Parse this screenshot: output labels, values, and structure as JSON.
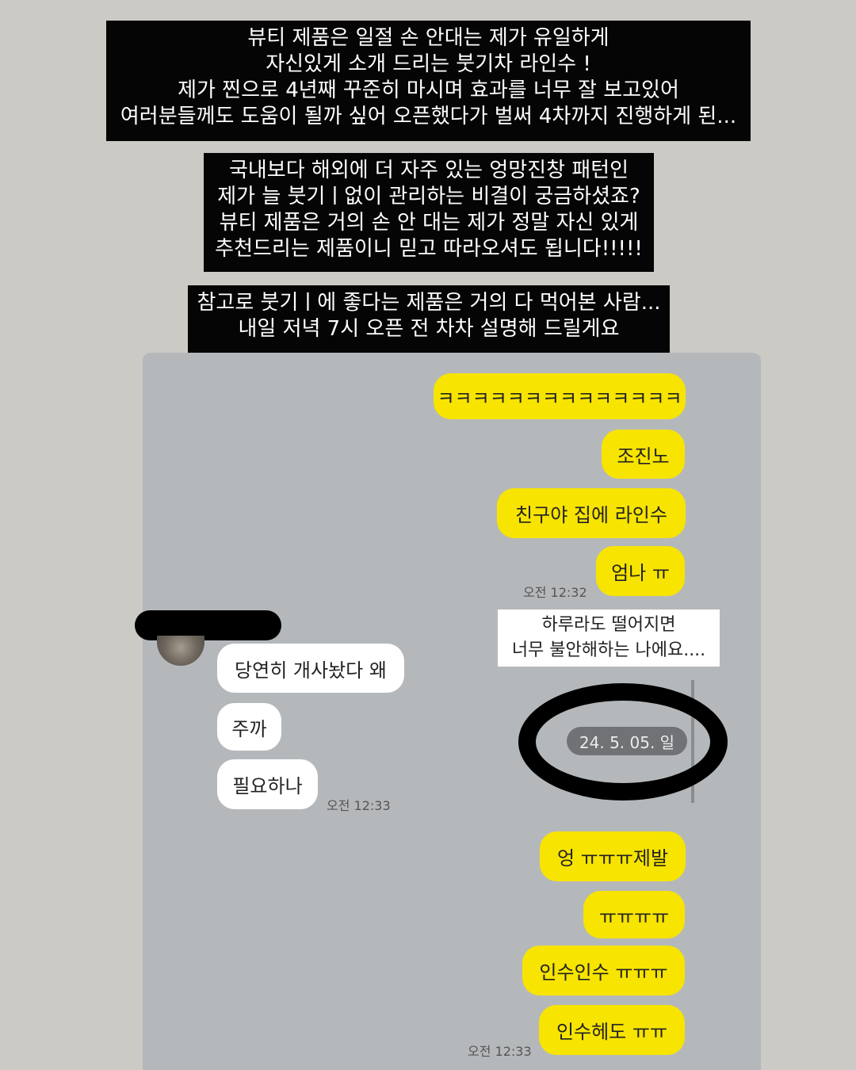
{
  "captions": [
    "뷰티 제품은 일절 손 안대는 제가 유일하게\n자신있게 소개 드리는 붓기차 라인수 !\n제가 찐으로 4년째 꾸준히 마시며 효과를 너무 잘 보고있어\n여러분들께도 도움이 될까 싶어 오픈했다가 벌써 4차까지 진행하게 된...",
    "국내보다 해외에 더 자주 있는 엉망진창 패턴인\n제가 늘 붓기ㅣ없이 관리하는 비결이 궁금하셨죠?\n뷰티 제품은 거의 손 안 대는 제가 정말 자신 있게\n추천드리는 제품이니 믿고 따라오셔도 됩니다!!!!!",
    "참고로 붓기ㅣ에 좋다는 제품은 거의 다 먹어본 사람...\n내일 저녁 7시 오픈 전 차차 설명해 드릴게요"
  ],
  "chat": {
    "my_messages_top": [
      "ㅋㅋㅋㅋㅋㅋㅋㅋㅋㅋㅋㅋㅋㅋ",
      "조진노",
      "친구야 집에 라인수",
      "엄나 ㅠ"
    ],
    "my_time_top": "오전 12:32",
    "sticker_text": "하루라도 떨어지면\n너무 불안해하는 나에요....",
    "date_divider": "24. 5. 05. 일",
    "friend_messages": [
      "당연히 개사놨다 왜",
      "주까",
      "필요하나"
    ],
    "friend_time": "오전 12:33",
    "my_messages_bottom": [
      "엉 ㅠㅠㅠ제발",
      "ㅠㅠㅠㅠ",
      "인수인수 ㅠㅠㅠ",
      "인수헤도 ㅠㅠ"
    ],
    "my_time_bottom": "오전 12:33"
  },
  "colors": {
    "page_background": "#cbcac5",
    "chat_background": "#b5b8bb",
    "my_bubble": "#f7e400",
    "friend_bubble": "#ffffff",
    "caption_background": "#050505",
    "date_pill": "#707275"
  }
}
